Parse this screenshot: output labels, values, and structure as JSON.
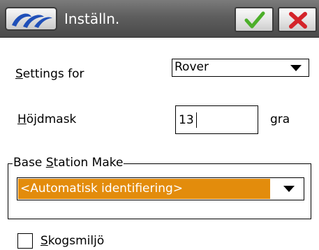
{
  "titlebar": {
    "title": "Inställn.",
    "logo_icon": "trimble-logo-icon",
    "ok_icon": "checkmark-icon",
    "cancel_icon": "close-x-icon",
    "ok_color": "#4caf2a",
    "cancel_color": "#d4242a"
  },
  "settings_for": {
    "label_first": "S",
    "label_rest": "ettings for",
    "value": "Rover"
  },
  "elevation_mask": {
    "label_first": "H",
    "label_rest": "öjdmask",
    "value": "13",
    "unit": "gra"
  },
  "base_station": {
    "title_prefix": "Base ",
    "title_accel": "S",
    "title_rest": "tation Make",
    "value": "<Automatisk identifiering>",
    "highlight_color": "#e38c0c"
  },
  "forest": {
    "label_first": "S",
    "label_rest": "kogsmiljö",
    "checked": false
  }
}
